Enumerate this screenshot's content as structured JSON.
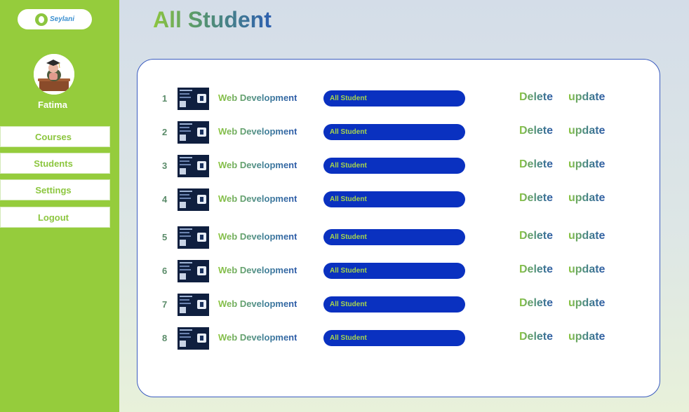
{
  "sidebar": {
    "logo_text": "Seylani",
    "user_name": "Fatima",
    "nav": [
      {
        "label": "Courses"
      },
      {
        "label": "Students"
      },
      {
        "label": "Settings"
      },
      {
        "label": "Logout"
      }
    ]
  },
  "page_title": "All Student",
  "rows": [
    {
      "num": "1",
      "course": "Web Development",
      "pill": "All Student",
      "delete": "Delete",
      "update": "update"
    },
    {
      "num": "2",
      "course": "Web Development",
      "pill": "All Student",
      "delete": "Delete",
      "update": "update"
    },
    {
      "num": "3",
      "course": "Web Development",
      "pill": "All Student",
      "delete": "Delete",
      "update": "update"
    },
    {
      "num": "4",
      "course": "Web Development",
      "pill": "All Student",
      "delete": "Delete",
      "update": "update"
    },
    {
      "num": "5",
      "course": "Web Development",
      "pill": "All Student",
      "delete": "Delete",
      "update": "update"
    },
    {
      "num": "6",
      "course": "Web Development",
      "pill": "All Student",
      "delete": "Delete",
      "update": "update"
    },
    {
      "num": "7",
      "course": "Web Development",
      "pill": "All Student",
      "delete": "Delete",
      "update": "update"
    },
    {
      "num": "8",
      "course": "Web Development",
      "pill": "All Student",
      "delete": "Delete",
      "update": "update"
    }
  ],
  "colors": {
    "sidebar": "#95cc3c",
    "accent_green": "#8cc63f",
    "accent_blue": "#0a31c0",
    "panel_border": "#3a5bbf"
  },
  "icons": {
    "logo": "logo-icon",
    "avatar": "graduate-avatar",
    "thumbnail": "course-thumbnail"
  }
}
